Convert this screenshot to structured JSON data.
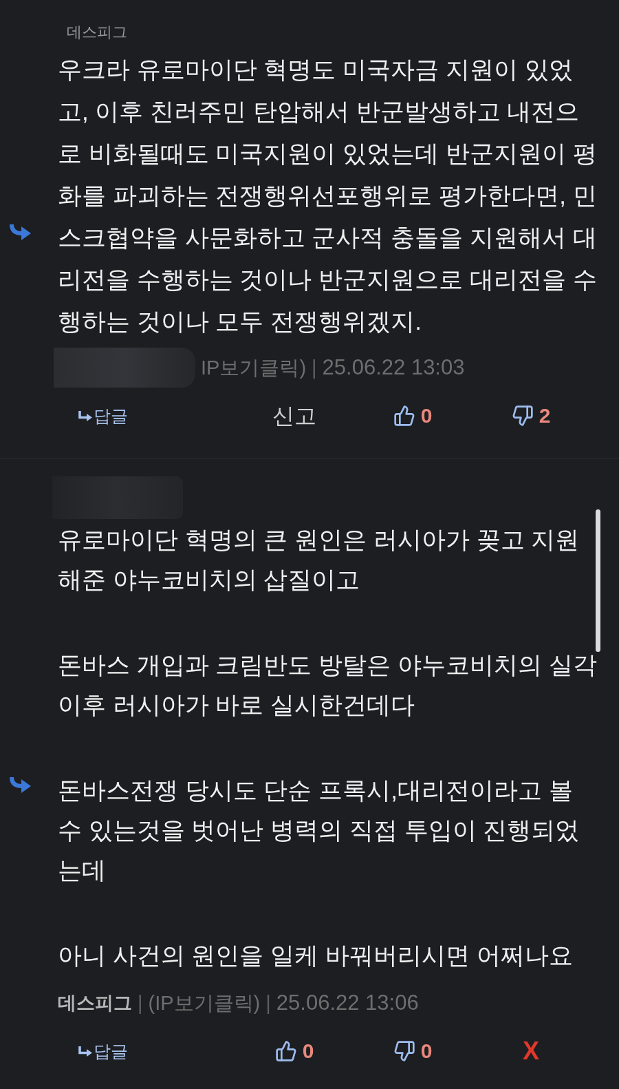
{
  "comments": [
    {
      "mention": {
        "kind": "name",
        "text": "데스피그"
      },
      "paragraphs": [
        "우크라 유로마이단 혁명도 미국자금 지원이 있었고, 이후 친러주민 탄압해서 반군발생하고 내전으로 비화될때도 미국지원이 있었는데 반군지원이 평화를 파괴하는 전쟁행위선포행위로 평가한다면, 민스크협약을 사문화하고 군사적 충돌을 지원해서 대리전을 수행하는 것이나 반군지원으로 대리전을 수행하는 것이나 모두 전쟁행위겠지."
      ],
      "meta": [
        {
          "kind": "redacted"
        },
        {
          "kind": "ip",
          "text": "IP보기클릭)"
        },
        {
          "kind": "separator",
          "text": "|"
        },
        {
          "kind": "date",
          "text": "25.06.22 13:03"
        }
      ],
      "actions": [
        {
          "kind": "reply",
          "label": "답글"
        },
        {
          "kind": "report",
          "label": "신고"
        },
        {
          "kind": "like",
          "count": "0"
        },
        {
          "kind": "dislike",
          "count": "2"
        }
      ]
    },
    {
      "mention": {
        "kind": "redacted"
      },
      "paragraphs": [
        "유로마이단 혁명의 큰 원인은 러시아가 꽂고 지원해준 야누코비치의 삽질이고",
        "돈바스 개입과 크림반도 방탈은 야누코비치의 실각 이후 러시아가 바로 실시한건데다",
        "돈바스전쟁 당시도 단순 프록시,대리전이라고 볼 수 있는것을 벗어난 병력의 직접 투입이 진행되었는데",
        "아니 사건의 원인을 일케 바꿔버리시면 어쩌나요"
      ],
      "meta": [
        {
          "kind": "author",
          "text": "데스피그"
        },
        {
          "kind": "separator",
          "text": "|"
        },
        {
          "kind": "ip",
          "text": "(IP보기클릭)"
        },
        {
          "kind": "separator",
          "text": "|"
        },
        {
          "kind": "date",
          "text": "25.06.22 13:06"
        }
      ],
      "actions": [
        {
          "kind": "reply",
          "label": "답글"
        },
        {
          "kind": "like",
          "count": "0"
        },
        {
          "kind": "dislike",
          "count": "0"
        },
        {
          "kind": "delete",
          "label": "X"
        }
      ]
    }
  ]
}
